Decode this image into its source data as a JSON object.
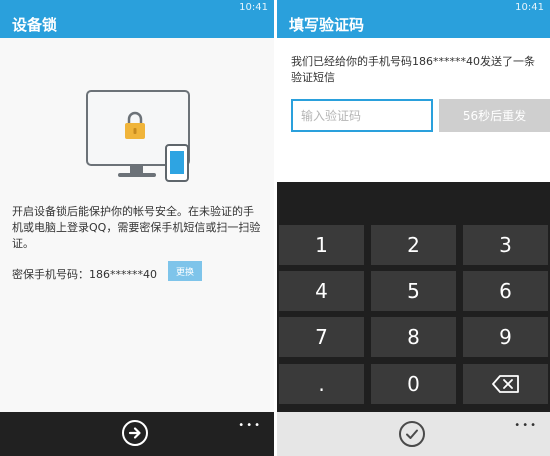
{
  "left": {
    "status_time": "10:41",
    "title": "设备锁",
    "description": "开启设备锁后能保护你的帐号安全。在未验证的手机或电脑上登录QQ，需要密保手机短信或扫一扫验证。",
    "phone_label": "密保手机号码：186******40",
    "change_label": "更换",
    "menu_label": "•••"
  },
  "right": {
    "status_time": "10:41",
    "title": "填写验证码",
    "sms_text": "我们已经给你的手机号码186******40发送了一条验证短信",
    "code_placeholder": "输入验证码",
    "resend_label": "56秒后重发",
    "keys": [
      "1",
      "2",
      "3",
      "4",
      "5",
      "6",
      "7",
      "8",
      "9",
      ".",
      "0"
    ],
    "menu_label": "•••"
  },
  "colors": {
    "accent": "#2aa0dc",
    "lock": "#f0b43a",
    "keypad_key": "#3a3a3a"
  },
  "icons": [
    "lock-icon",
    "monitor-icon",
    "phone-icon",
    "arrow-right-circle-icon",
    "backspace-icon",
    "check-circle-icon",
    "more-dots-icon"
  ]
}
